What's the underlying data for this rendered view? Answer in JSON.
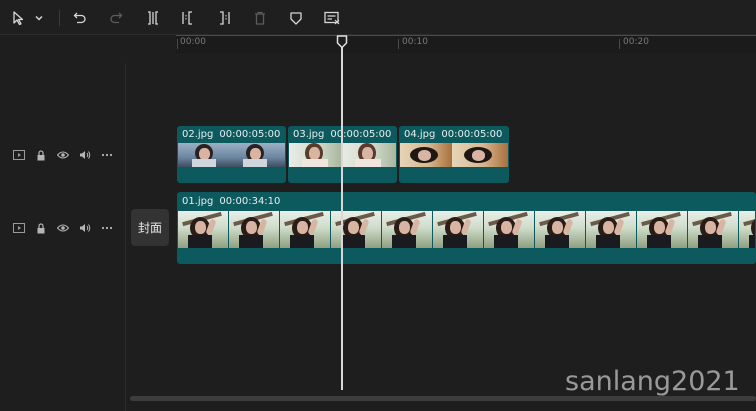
{
  "toolbar": {
    "items": [
      {
        "name": "select-tool",
        "icon": "cursor-arrow-icon"
      },
      {
        "name": "select-dropdown",
        "icon": "chevron-down-icon"
      },
      {
        "name": "undo",
        "icon": "undo-icon"
      },
      {
        "name": "redo",
        "icon": "redo-icon",
        "disabled": true
      },
      {
        "name": "split",
        "icon": "split-icon"
      },
      {
        "name": "trim-left",
        "icon": "trim-left-icon"
      },
      {
        "name": "trim-right",
        "icon": "trim-right-icon"
      },
      {
        "name": "delete",
        "icon": "trash-icon",
        "disabled": true
      },
      {
        "name": "marker",
        "icon": "marker-shield-icon"
      },
      {
        "name": "captions",
        "icon": "caption-icon"
      }
    ]
  },
  "ruler": {
    "labels": [
      "00:00",
      "00:10",
      "00:20"
    ]
  },
  "tracks": [
    {
      "controls": [
        "video-track-icon",
        "lock-icon",
        "eye-icon",
        "volume-icon",
        "more-icon"
      ],
      "clips": [
        {
          "name": "02.jpg",
          "duration": "00:00:05:00"
        },
        {
          "name": "03.jpg",
          "duration": "00:00:05:00"
        },
        {
          "name": "04.jpg",
          "duration": "00:00:05:00"
        }
      ]
    },
    {
      "controls": [
        "video-track-icon",
        "lock-icon",
        "eye-icon",
        "volume-icon",
        "more-icon"
      ],
      "cover_label": "封面",
      "clips": [
        {
          "name": "01.jpg",
          "duration": "00:00:34:10"
        }
      ]
    }
  ],
  "colors": {
    "background": "#1e1e1e",
    "clip": "#0d5a5e",
    "playhead": "#d8d8d8"
  },
  "watermark": "sanlang2021"
}
